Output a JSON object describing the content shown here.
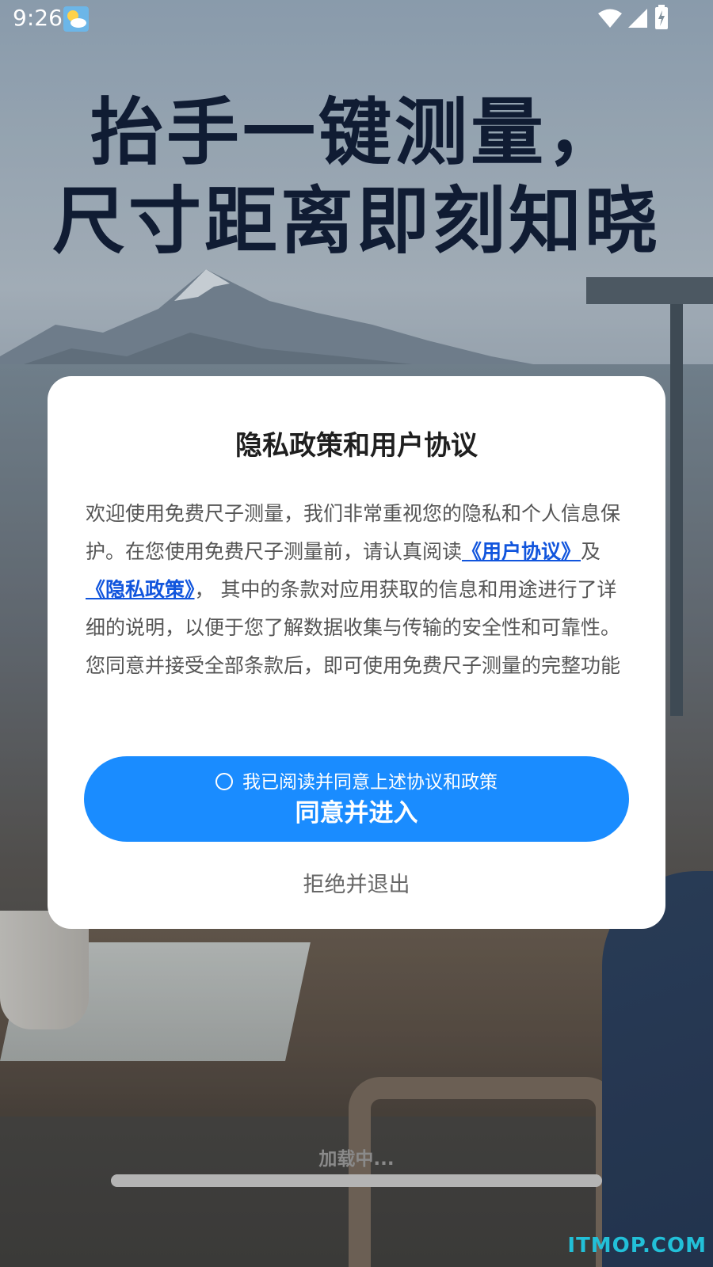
{
  "status_bar": {
    "time": "9:26",
    "icons": [
      "weather-icon",
      "wifi-icon",
      "signal-icon",
      "battery-charging-icon"
    ]
  },
  "headline": {
    "line1": "抬手一键测量，",
    "line2": "尺寸距离即刻知晓"
  },
  "dialog": {
    "title": "隐私政策和用户协议",
    "body_intro": "欢迎使用免费尺子测量，我们非常重视您的隐私和个人信息保护。在您使用免费尺子测量前，请认真阅读",
    "user_agreement_link": "《用户协议》",
    "connector": "及",
    "privacy_policy_link": "《隐私政策》",
    "body_rest": "， 其中的条款对应用获取的信息和用途进行了详细的说明，以便于您了解数据收集与传输的安全性和可靠性。您同意并接受全部条款后，即可使用免费尺子测量的完整功能",
    "agree_checkbox_label": "我已阅读并同意上述协议和政策",
    "agree_checked": false,
    "agree_button_label": "同意并进入",
    "reject_label": "拒绝并退出"
  },
  "loading": {
    "text": "加载中...",
    "progress": 1.0
  },
  "watermark": "ITMOP.COM",
  "colors": {
    "primary_button": "#1a8cff",
    "link": "#1155dd",
    "headline": "#101c33",
    "watermark": "#22c0d8"
  }
}
